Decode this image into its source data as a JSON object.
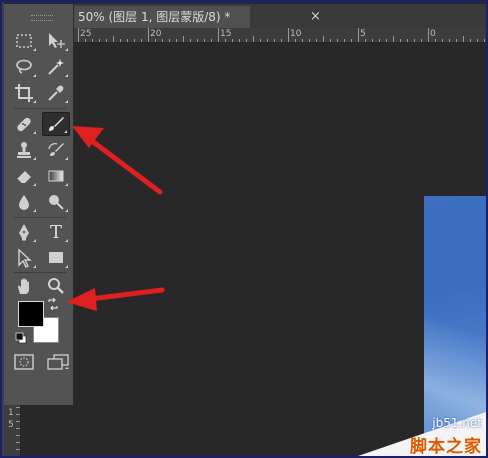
{
  "document_tab": {
    "title": "50% (图层 1, 图层蒙版/8) *",
    "close_glyph": "×"
  },
  "ruler": {
    "h_labels": [
      "25",
      "20",
      "15",
      "10",
      "5",
      "0"
    ],
    "v_labels": [
      "1",
      "5"
    ]
  },
  "toolbar": {
    "tools": [
      {
        "name": "rectangular-marquee-tool",
        "icon": "rect-marquee-icon"
      },
      {
        "name": "move-tool",
        "icon": "move-icon"
      },
      {
        "name": "lasso-tool",
        "icon": "lasso-icon"
      },
      {
        "name": "magic-wand-tool",
        "icon": "magic-wand-icon"
      },
      {
        "name": "crop-tool",
        "icon": "crop-icon"
      },
      {
        "name": "eyedropper-tool",
        "icon": "eyedropper-icon"
      },
      {
        "name": "spot-healing-brush-tool",
        "icon": "bandage-icon"
      },
      {
        "name": "brush-tool",
        "icon": "brush-icon",
        "active": true
      },
      {
        "name": "clone-stamp-tool",
        "icon": "stamp-icon"
      },
      {
        "name": "history-brush-tool",
        "icon": "history-brush-icon"
      },
      {
        "name": "eraser-tool",
        "icon": "eraser-icon"
      },
      {
        "name": "gradient-tool",
        "icon": "gradient-icon"
      },
      {
        "name": "blur-tool",
        "icon": "drop-icon"
      },
      {
        "name": "dodge-tool",
        "icon": "dodge-icon"
      },
      {
        "name": "pen-tool",
        "icon": "pen-icon"
      },
      {
        "name": "type-tool",
        "icon": "type-icon",
        "glyph": "T"
      },
      {
        "name": "path-selection-tool",
        "icon": "path-select-icon"
      },
      {
        "name": "rectangle-tool",
        "icon": "rectangle-shape-icon"
      },
      {
        "name": "hand-tool",
        "icon": "hand-icon"
      },
      {
        "name": "zoom-tool",
        "icon": "zoom-icon"
      }
    ],
    "foreground_color": "#000000",
    "background_color": "#ffffff"
  },
  "watermark": {
    "url": "jb51.net",
    "name": "脚本之家"
  },
  "colors": {
    "annotation_arrow": "#e02020",
    "ui_panel": "#535353",
    "workspace": "#282828",
    "frame": "#1a1f6e"
  }
}
